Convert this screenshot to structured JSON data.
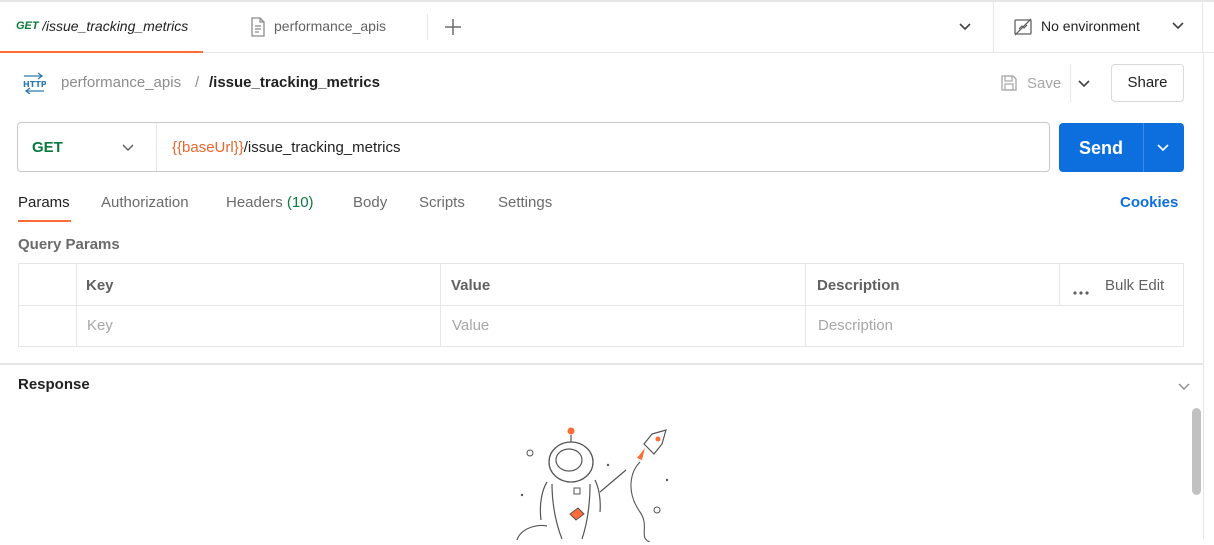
{
  "tabs": {
    "active": {
      "method": "GET",
      "name": "/issue_tracking_metrics"
    },
    "second": {
      "name": "performance_apis"
    },
    "environment": "No environment"
  },
  "breadcrumb": {
    "parent": "performance_apis",
    "separator": "/",
    "current": "/issue_tracking_metrics"
  },
  "toolbar": {
    "save_label": "Save",
    "share_label": "Share"
  },
  "request": {
    "method": "GET",
    "url_variable": "{{baseUrl}}",
    "url_path": "/issue_tracking_metrics",
    "send_label": "Send"
  },
  "request_tabs": [
    {
      "label": "Params"
    },
    {
      "label": "Authorization"
    },
    {
      "label": "Headers",
      "count": "(10)"
    },
    {
      "label": "Body"
    },
    {
      "label": "Scripts"
    },
    {
      "label": "Settings"
    }
  ],
  "cookies_label": "Cookies",
  "query_params": {
    "title": "Query Params",
    "columns": [
      "Key",
      "Value",
      "Description"
    ],
    "bulk_edit": "Bulk Edit",
    "placeholders": [
      "Key",
      "Value",
      "Description"
    ]
  },
  "response": {
    "title": "Response"
  },
  "colors": {
    "accent": "#ff6c37",
    "send": "#0d6fde",
    "method_get": "#0b7a3e",
    "variable": "#e6672e"
  },
  "icons": [
    "document-icon",
    "plus-icon",
    "chevron-down-icon",
    "no-environment-icon",
    "http-icon",
    "save-icon",
    "more-icon",
    "astronaut-illustration"
  ]
}
